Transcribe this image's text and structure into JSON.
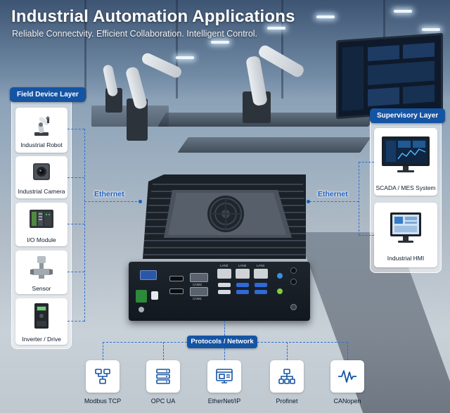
{
  "header": {
    "title": "Industrial Automation Applications",
    "subtitle": "Reliable Connectvity. Efficient Collaboration. Intelligent Control."
  },
  "field_layer": {
    "title": "Field Device Layer",
    "devices": [
      {
        "label": "Industrial Robot",
        "icon": "robot-arm-icon"
      },
      {
        "label": "Industrial Camera",
        "icon": "camera-icon"
      },
      {
        "label": "I/O Module",
        "icon": "io-module-icon"
      },
      {
        "label": "Sensor",
        "icon": "sensor-icon"
      },
      {
        "label": "Inverter / Drive",
        "icon": "inverter-icon"
      }
    ]
  },
  "supervisory_layer": {
    "title": "Supervisory Layer",
    "devices": [
      {
        "label": "SCADA / MES System",
        "icon": "scada-monitor-icon"
      },
      {
        "label": "Industrial HMI",
        "icon": "hmi-panel-icon"
      }
    ]
  },
  "connections": {
    "left": "Ethernet",
    "right": "Ethernet"
  },
  "device_ports": {
    "lan1": "LAN3",
    "lan2": "LAN2",
    "lan3": "LAN1",
    "com1": "COM2",
    "com2": "COM1"
  },
  "protocols": {
    "title": "Protocols / Network",
    "items": [
      {
        "label": "Modbus TCP",
        "icon": "network-topology-icon"
      },
      {
        "label": "OPC UA",
        "icon": "server-stack-icon"
      },
      {
        "label": "EtherNet/IP",
        "icon": "ethernet-ip-icon"
      },
      {
        "label": "Profinet",
        "icon": "network-tree-icon"
      },
      {
        "label": "CANopen",
        "icon": "waveform-icon"
      }
    ]
  },
  "colors": {
    "accent": "#1554a3",
    "connector": "#2b6fd1",
    "title_text": "#ffffff"
  }
}
